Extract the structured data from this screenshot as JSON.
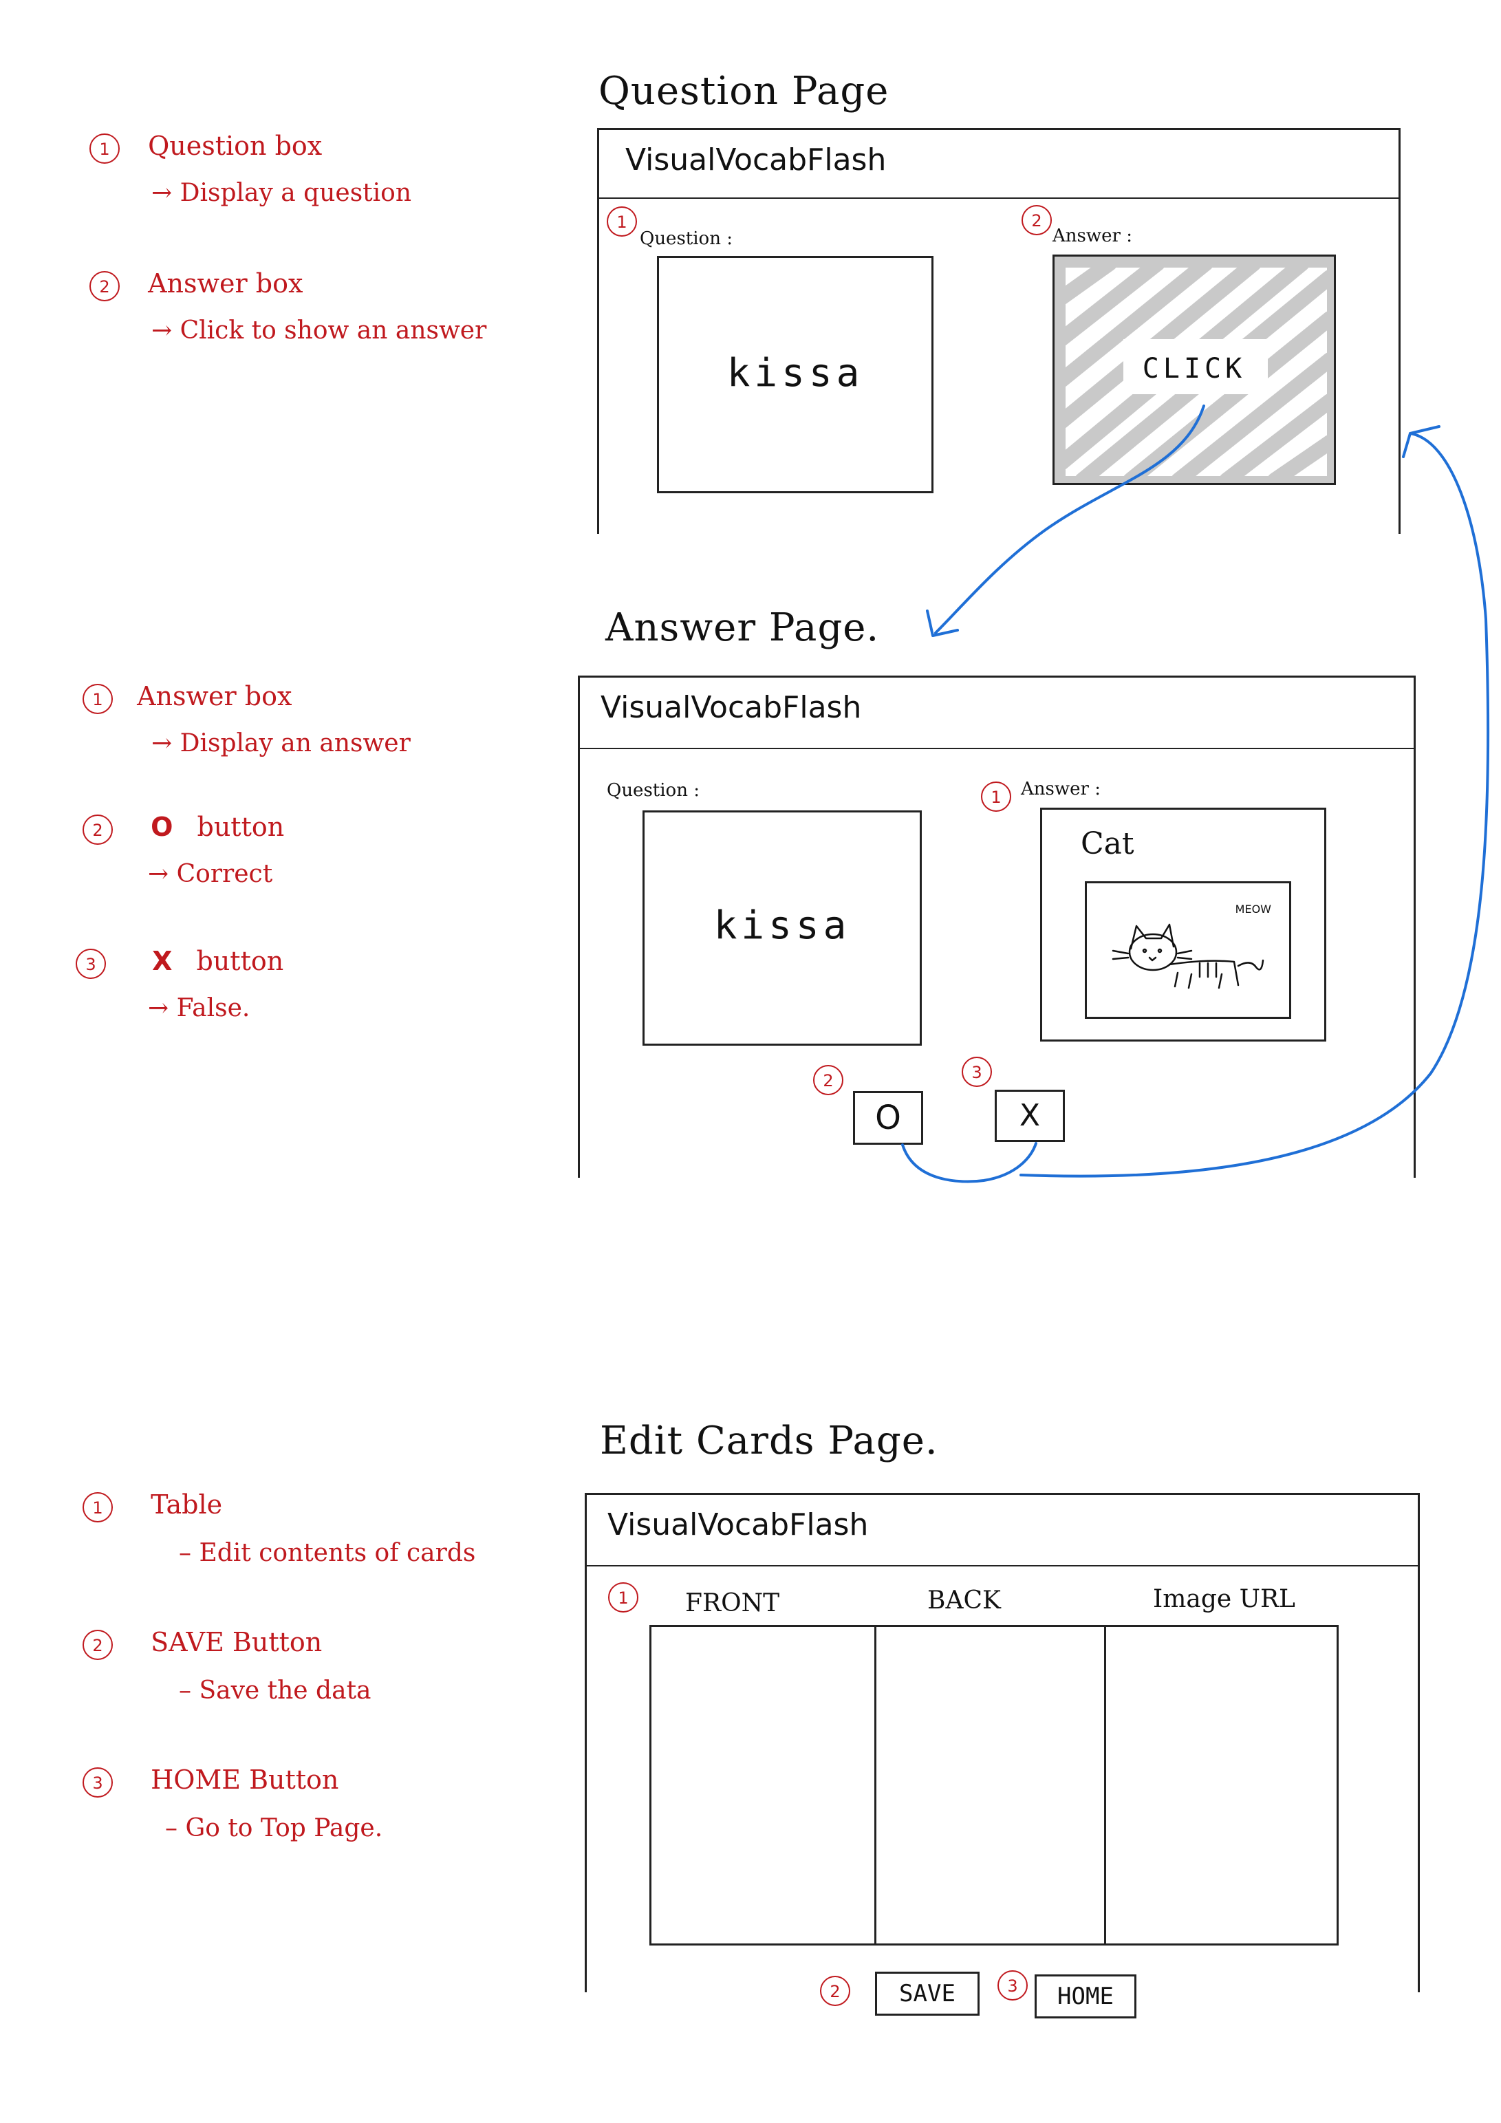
{
  "question_page": {
    "page_title": "Question Page",
    "app_title": "VisualVocabFlash",
    "question_label": "Question :",
    "answer_label": "Answer :",
    "question_word": "kissa",
    "click_text": "CLICK",
    "num1": "1",
    "num2": "2"
  },
  "answer_page": {
    "page_title": "Answer Page.",
    "app_title": "VisualVocabFlash",
    "question_label": "Question :",
    "answer_label": "Answer :",
    "question_word": "kissa",
    "answer_word": "Cat",
    "meow": "MEOW",
    "correct_symbol": "O",
    "false_symbol": "X",
    "num1": "1",
    "num2": "2",
    "num3": "3"
  },
  "edit_page": {
    "page_title": "Edit Cards Page.",
    "app_title": "VisualVocabFlash",
    "columns": [
      "FRONT",
      "BACK",
      "Image URL"
    ],
    "save_label": "SAVE",
    "home_label": "HOME",
    "num1": "1",
    "num2": "2",
    "num3": "3"
  },
  "notes": {
    "question": [
      {
        "num": "1",
        "title": "Question box",
        "desc": "→ Display a question"
      },
      {
        "num": "2",
        "title": "Answer box",
        "desc": "→ Click to show an answer"
      }
    ],
    "answer": [
      {
        "num": "1",
        "title": "Answer box",
        "desc": "→ Display an answer"
      },
      {
        "num": "2",
        "symbol": "O",
        "title": "button",
        "desc": "→ Correct"
      },
      {
        "num": "3",
        "symbol": "X",
        "title": "button",
        "desc": "→ False."
      }
    ],
    "edit": [
      {
        "num": "1",
        "title": "Table",
        "desc": "– Edit contents of cards"
      },
      {
        "num": "2",
        "title": "SAVE Button",
        "desc": "– Save the data"
      },
      {
        "num": "3",
        "title": "HOME Button",
        "desc": "– Go to Top Page."
      }
    ]
  },
  "colors": {
    "annotation": "#c0191e",
    "arrow": "#1f6fd6",
    "ink": "#111111",
    "scribble": "#c9c9c9"
  }
}
